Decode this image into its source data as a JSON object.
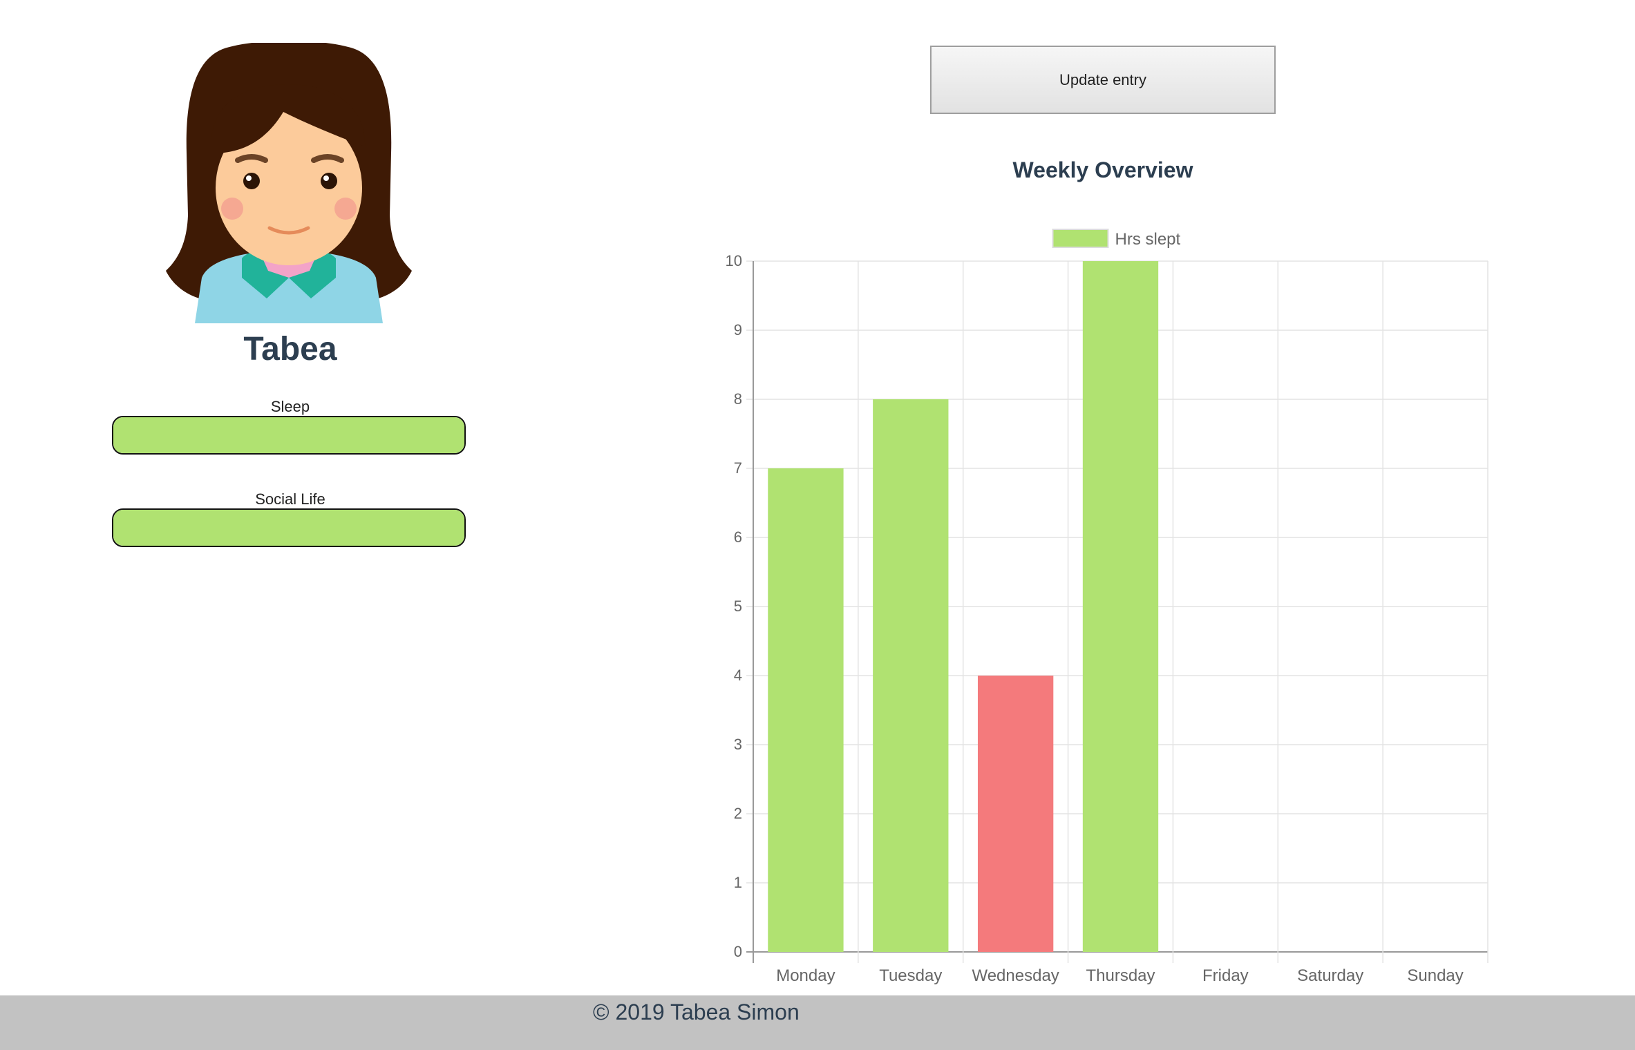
{
  "profile": {
    "name": "Tabea",
    "avatar_icon": "girl-avatar-icon"
  },
  "stats": [
    {
      "label": "Sleep",
      "level_percent": 100
    },
    {
      "label": "Social Life",
      "level_percent": 100
    }
  ],
  "actions": {
    "update_label": "Update entry"
  },
  "chart_title": "Weekly Overview",
  "colors": {
    "good": "#b0e271",
    "bad": "#f47a7c"
  },
  "chart_data": {
    "type": "bar",
    "categories": [
      "Monday",
      "Tuesday",
      "Wednesday",
      "Thursday",
      "Friday",
      "Saturday",
      "Sunday"
    ],
    "series": [
      {
        "name": "Hrs slept",
        "values": [
          7,
          8,
          4,
          10,
          0,
          0,
          0
        ]
      }
    ],
    "bar_colors": [
      "#b0e271",
      "#b0e271",
      "#f47a7c",
      "#b0e271",
      "#b0e271",
      "#b0e271",
      "#b0e271"
    ],
    "ylim": [
      0,
      10
    ],
    "yticks": [
      0,
      1,
      2,
      3,
      4,
      5,
      6,
      7,
      8,
      9,
      10
    ],
    "grid": true,
    "legend": "top"
  },
  "footer": {
    "copyright": "© 2019 Tabea Simon"
  }
}
